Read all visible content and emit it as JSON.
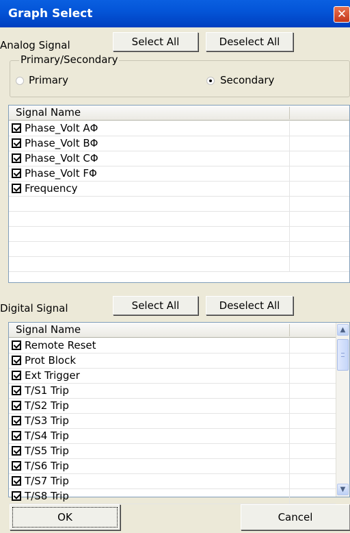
{
  "window": {
    "title": "Graph Select",
    "close_glyph": "✕"
  },
  "analog": {
    "label": "Analog Signal",
    "select_all": "Select All",
    "deselect_all": "Deselect All",
    "group_title": "Primary/Secondary",
    "primary_label": "Primary",
    "secondary_label": "Secondary",
    "selected": "Secondary",
    "column_header": "Signal Name",
    "items": [
      {
        "label": "Phase_Volt AΦ",
        "checked": true
      },
      {
        "label": "Phase_Volt BΦ",
        "checked": true
      },
      {
        "label": "Phase_Volt CΦ",
        "checked": true
      },
      {
        "label": "Phase_Volt FΦ",
        "checked": true
      },
      {
        "label": "Frequency",
        "checked": true
      }
    ]
  },
  "digital": {
    "label": "Digital Signal",
    "select_all": "Select All",
    "deselect_all": "Deselect All",
    "column_header": "Signal Name",
    "items": [
      {
        "label": "Remote Reset",
        "checked": true
      },
      {
        "label": "Prot Block",
        "checked": true
      },
      {
        "label": "Ext Trigger",
        "checked": true
      },
      {
        "label": "T/S1 Trip",
        "checked": true
      },
      {
        "label": "T/S2 Trip",
        "checked": true
      },
      {
        "label": "T/S3 Trip",
        "checked": true
      },
      {
        "label": "T/S4 Trip",
        "checked": true
      },
      {
        "label": "T/S5 Trip",
        "checked": true
      },
      {
        "label": "T/S6 Trip",
        "checked": true
      },
      {
        "label": "T/S7 Trip",
        "checked": true
      },
      {
        "label": "T/S8 Trip",
        "checked": true
      }
    ]
  },
  "footer": {
    "ok": "OK",
    "cancel": "Cancel"
  },
  "icons": {
    "scroll_up": "chevron-up-icon",
    "scroll_down": "chevron-down-icon"
  },
  "colors": {
    "titlebar": "#0455d8",
    "dialog_bg": "#ece9d8",
    "close_button": "#d8552e"
  }
}
